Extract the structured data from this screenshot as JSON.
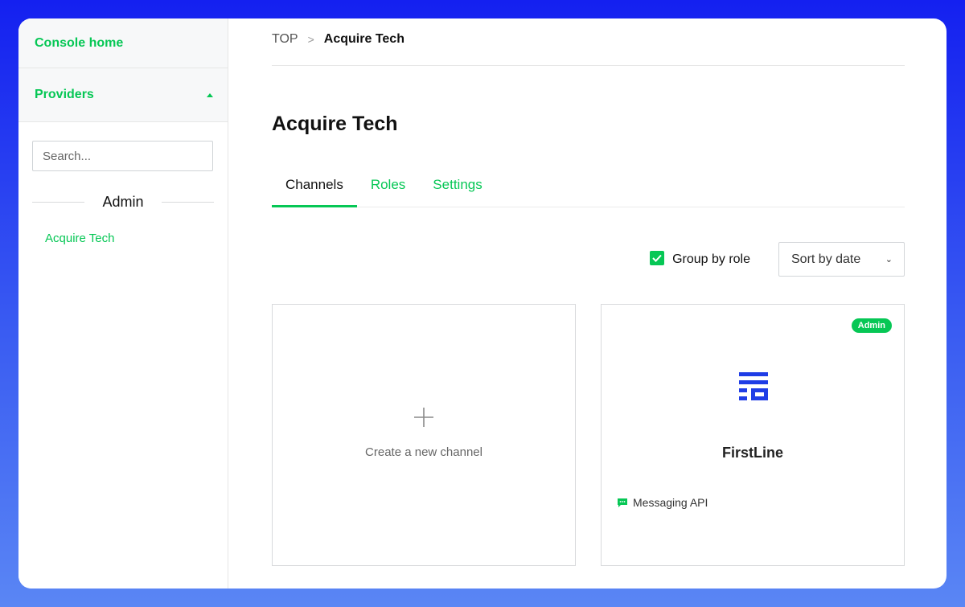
{
  "sidebar": {
    "console_home": "Console home",
    "providers": "Providers",
    "search_placeholder": "Search...",
    "section_label": "Admin",
    "items": [
      {
        "label": "Acquire Tech"
      }
    ]
  },
  "breadcrumb": {
    "root": "TOP",
    "separator": ">",
    "current": "Acquire Tech"
  },
  "page": {
    "title": "Acquire Tech"
  },
  "tabs": [
    {
      "label": "Channels",
      "active": true
    },
    {
      "label": "Roles",
      "active": false
    },
    {
      "label": "Settings",
      "active": false
    }
  ],
  "toolbar": {
    "group_by_role_label": "Group by role",
    "group_by_role_checked": true,
    "sort_selected": "Sort by date"
  },
  "cards": {
    "create": {
      "icon": "plus-icon",
      "label": "Create a new channel"
    },
    "channels": [
      {
        "name": "FirstLine",
        "badge": "Admin",
        "type": "Messaging API",
        "logo_color": "#1f3de6",
        "type_icon": "chat-bubble-icon"
      }
    ]
  },
  "colors": {
    "accent": "#06c755",
    "background_gradient_top": "#1420f0",
    "background_gradient_bottom": "#5a86f4"
  }
}
